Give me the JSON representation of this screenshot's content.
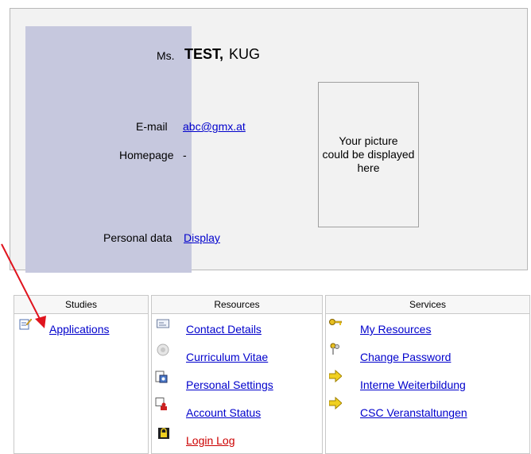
{
  "profile": {
    "salutation": "Ms.",
    "last_name": "TEST,",
    "first_name": "KUG",
    "email_label": "E-mail",
    "email_value": "abc@gmx.at",
    "homepage_label": "Homepage",
    "homepage_value": "-",
    "personal_data_label": "Personal data",
    "personal_data_link": "Display",
    "photo_placeholder_line1": "Your picture",
    "photo_placeholder_line2": "could be displayed",
    "photo_placeholder_line3": "here"
  },
  "menus": {
    "studies": {
      "title": "Studies",
      "items": [
        {
          "label": "Applications",
          "icon": "edit-note-icon"
        }
      ]
    },
    "resources": {
      "title": "Resources",
      "items": [
        {
          "label": "Contact Details",
          "icon": "address-card-icon"
        },
        {
          "label": "Curriculum Vitae",
          "icon": "cv-badge-icon"
        },
        {
          "label": "Personal Settings",
          "icon": "settings-document-icon"
        },
        {
          "label": "Account Status",
          "icon": "account-status-icon"
        },
        {
          "label": "Login Log",
          "icon": "lock-icon"
        }
      ]
    },
    "services": {
      "title": "Services",
      "items": [
        {
          "label": "My Resources",
          "icon": "key-icon"
        },
        {
          "label": "Change Password",
          "icon": "keys-icon"
        },
        {
          "label": "Interne Weiterbildung",
          "icon": "arrow-sign-icon"
        },
        {
          "label": "CSC Veranstaltungen",
          "icon": "arrow-sign-icon"
        }
      ]
    }
  },
  "colors": {
    "link": "#0000cc",
    "login_log_link": "#cc0000",
    "side_band": "#c6c8de",
    "annotation_arrow": "#e0141e"
  }
}
